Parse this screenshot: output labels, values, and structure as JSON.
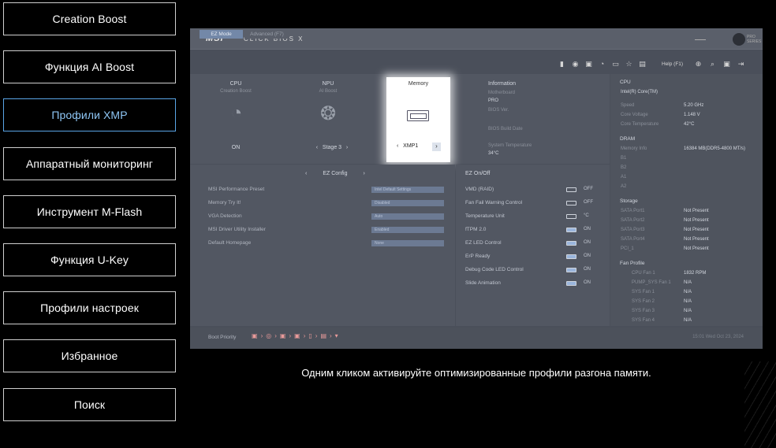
{
  "menu": [
    {
      "label": "Creation Boost",
      "active": false
    },
    {
      "label": "Функция AI Boost",
      "active": false
    },
    {
      "label": "Профили XMP",
      "active": true
    },
    {
      "label": "Аппаратный мониторинг",
      "active": false
    },
    {
      "label": "Инструмент M-Flash",
      "active": false
    },
    {
      "label": "Функция U-Key",
      "active": false
    },
    {
      "label": "Профили настроек",
      "active": false
    },
    {
      "label": "Избранное",
      "active": false
    },
    {
      "label": "Поиск",
      "active": false
    }
  ],
  "bios": {
    "logo": "MSI",
    "title": "CLICK BIOS X",
    "series": "PRO SERIES",
    "tabs": {
      "ez": "EZ Mode",
      "advanced": "Advanced (F7)"
    },
    "help": "Help (F1)",
    "columns": {
      "cpu": {
        "label": "CPU",
        "sub": "Creation Boost",
        "foot": "ON"
      },
      "npu": {
        "label": "NPU",
        "sub": "AI Boost",
        "foot": "Stage 3"
      },
      "memory": {
        "label": "Memory",
        "foot": "XMP1"
      }
    },
    "info": {
      "title": "Information",
      "lines": [
        "Motherboard",
        "PRO",
        "BIOS Ver.",
        "",
        "BIOS Build Date",
        "",
        "System Temperature",
        "34°C"
      ]
    },
    "cpu_panel": {
      "title": "CPU",
      "name": "Intel(R) Core(TM)",
      "rows": [
        {
          "k": "Speed",
          "v": "5.20 GHz"
        },
        {
          "k": "Core Voltage",
          "v": "1.148 V"
        },
        {
          "k": "Core Temperature",
          "v": "42°C"
        }
      ]
    },
    "dram_panel": {
      "title": "DRAM",
      "rows": [
        {
          "k": "Memory Info",
          "v": "16384 MB(DDR5-4800 MT/s)"
        },
        {
          "k": "B1",
          "v": ""
        },
        {
          "k": "B2",
          "v": ""
        },
        {
          "k": "A1",
          "v": ""
        },
        {
          "k": "A2",
          "v": ""
        }
      ]
    },
    "storage_panel": {
      "title": "Storage",
      "rows": [
        {
          "k": "SATA Port1",
          "v": "Not Present"
        },
        {
          "k": "SATA Port2",
          "v": "Not Present"
        },
        {
          "k": "SATA Port3",
          "v": "Not Present"
        },
        {
          "k": "SATA Port4",
          "v": "Not Present"
        },
        {
          "k": "PCI_1",
          "v": "Not Present"
        }
      ]
    },
    "fan_panel": {
      "title": "Fan Profile",
      "rows": [
        {
          "k": "CPU Fan 1",
          "v": "1832 RPM"
        },
        {
          "k": "PUMP_SYS Fan 1",
          "v": "N/A"
        },
        {
          "k": "SYS Fan 1",
          "v": "N/A"
        },
        {
          "k": "SYS Fan 2",
          "v": "N/A"
        },
        {
          "k": "SYS Fan 3",
          "v": "N/A"
        },
        {
          "k": "SYS Fan 4",
          "v": "N/A"
        }
      ]
    },
    "ez_config": {
      "title": "EZ Config",
      "rows": [
        {
          "k": "MSI Performance Preset",
          "v": "Intel Default Settings"
        },
        {
          "k": "Memory Try It!",
          "v": "Disabled"
        },
        {
          "k": "VGA Detection",
          "v": "Auto"
        },
        {
          "k": "MSI Driver Utility Installer",
          "v": "Enabled"
        },
        {
          "k": "Default Homepage",
          "v": "None"
        }
      ]
    },
    "ez_onoff": {
      "title": "EZ On/Off",
      "rows": [
        {
          "k": "VMD (RAID)",
          "v": "OFF",
          "on": false
        },
        {
          "k": "Fan Fail Warning Control",
          "v": "OFF",
          "on": false
        },
        {
          "k": "Temperature Unit",
          "v": "°C",
          "on": false
        },
        {
          "k": "fTPM 2.0",
          "v": "ON",
          "on": true
        },
        {
          "k": "EZ LED Control",
          "v": "ON",
          "on": true
        },
        {
          "k": "ErP Ready",
          "v": "ON",
          "on": true
        },
        {
          "k": "Debug Code LED Control",
          "v": "ON",
          "on": true
        },
        {
          "k": "Slide Animation",
          "v": "ON",
          "on": true
        }
      ]
    },
    "boot_priority": "Boot Priority",
    "datetime": "15:01  Wed Oct 23, 2024"
  },
  "caption": "Одним кликом активируйте оптимизированные профили разгона памяти."
}
